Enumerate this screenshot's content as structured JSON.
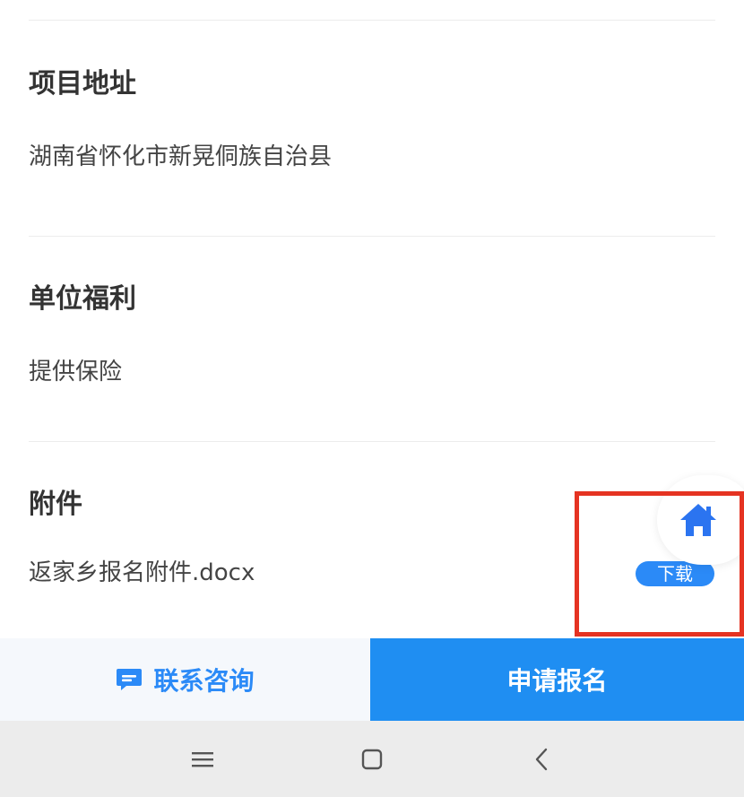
{
  "sections": [
    {
      "title": "项目地址",
      "value": "湖南省怀化市新晃侗族自治县"
    },
    {
      "title": "单位福利",
      "value": "提供保险"
    },
    {
      "title": "附件",
      "value": "返家乡报名附件.docx"
    }
  ],
  "attachment": {
    "download_label": "下载"
  },
  "actions": {
    "consult_label": "联系咨询",
    "apply_label": "申请报名"
  },
  "icons": {
    "home": "home-icon",
    "chat": "chat-icon",
    "menu": "menu-icon",
    "square": "home-square-icon",
    "back": "back-chevron-icon"
  },
  "colors": {
    "accent": "#1f8ef2",
    "highlight": "#e53322",
    "badge": "#2b8af7"
  }
}
